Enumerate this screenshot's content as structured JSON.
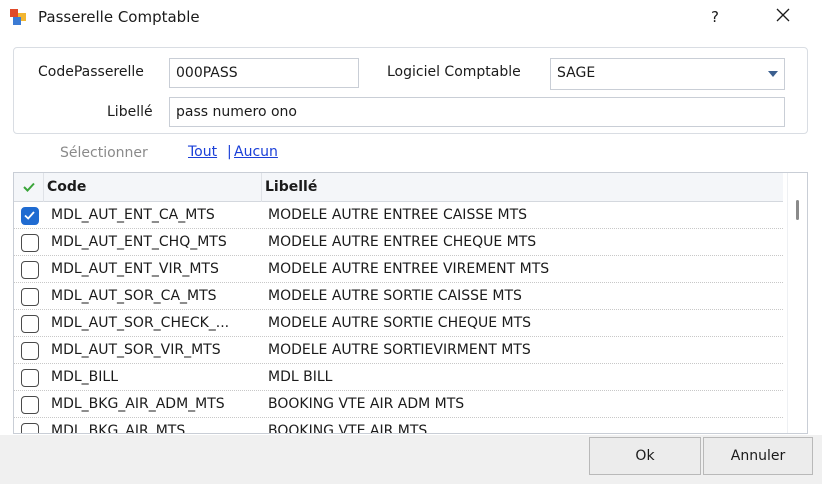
{
  "window": {
    "title": "Passerelle Comptable",
    "help_label": "?"
  },
  "form": {
    "code_label": "CodePasserelle",
    "code_value": "000PASS",
    "logiciel_label": "Logiciel Comptable",
    "logiciel_value": "SAGE",
    "libelle_label": "Libellé",
    "libelle_value": "pass numero ono"
  },
  "selection": {
    "label": "Sélectionner",
    "all_link": "Tout",
    "separator": "|",
    "none_link": "Aucun"
  },
  "grid": {
    "columns": [
      "Code",
      "Libellé"
    ],
    "rows": [
      {
        "checked": true,
        "code": "MDL_AUT_ENT_CA_MTS",
        "libelle": "MODELE AUTRE ENTREE CAISSE MTS"
      },
      {
        "checked": false,
        "code": "MDL_AUT_ENT_CHQ_MTS",
        "libelle": "MODELE AUTRE ENTREE CHEQUE MTS"
      },
      {
        "checked": false,
        "code": "MDL_AUT_ENT_VIR_MTS",
        "libelle": "MODELE AUTRE ENTREE VIREMENT MTS"
      },
      {
        "checked": false,
        "code": "MDL_AUT_SOR_CA_MTS",
        "libelle": "MODELE AUTRE SORTIE CAISSE MTS"
      },
      {
        "checked": false,
        "code": "MDL_AUT_SOR_CHECK_...",
        "libelle": "MODELE AUTRE SORTIE CHEQUE MTS"
      },
      {
        "checked": false,
        "code": "MDL_AUT_SOR_VIR_MTS",
        "libelle": "MODELE AUTRE SORTIEVIRMENT MTS"
      },
      {
        "checked": false,
        "code": "MDL_BILL",
        "libelle": "MDL BILL"
      },
      {
        "checked": false,
        "code": "MDL_BKG_AIR_ADM_MTS",
        "libelle": "BOOKING VTE AIR ADM MTS"
      },
      {
        "checked": false,
        "code": "MDL_BKG_AIR_MTS",
        "libelle": "BOOKING VTE AIR MTS"
      }
    ]
  },
  "buttons": {
    "ok": "Ok",
    "cancel": "Annuler"
  },
  "colors": {
    "link": "#1a3fd8",
    "checkbox_checked": "#1f6bd1",
    "header_check": "#3aa53a"
  }
}
